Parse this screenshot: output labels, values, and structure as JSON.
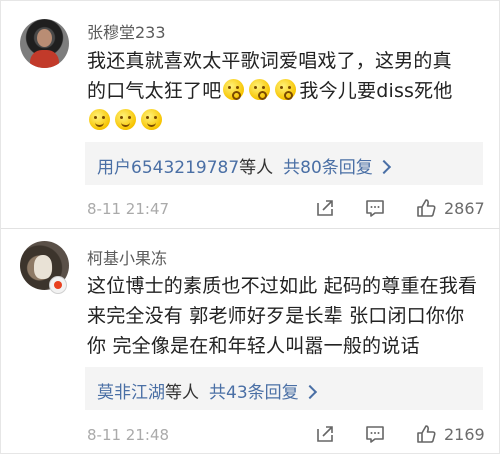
{
  "comments": [
    {
      "username": "张穆堂233",
      "text_line1": "我还真就喜欢太平歌词爱唱戏了，这男的真",
      "text_line2": "的口气太狂了吧",
      "text_after_emojis": "我今儿要diss死他",
      "emojis_inline": [
        "thinking-emoji",
        "thinking-emoji",
        "thinking-emoji"
      ],
      "emojis_line3": [
        "smile-emoji",
        "smile-emoji",
        "smile-emoji"
      ],
      "reply_user": "用户6543219787",
      "reply_suffix": "等人",
      "reply_count": "共80条回复",
      "timestamp": "8-11 21:47",
      "likes": "2867"
    },
    {
      "username": "柯基小果冻",
      "text": "这位博士的素质也不过如此 起码的尊重在我看来完全没有 郭老师好歹是长辈 张口闭口你你你 完全像是在和年轻人叫嚣一般的说话",
      "reply_user": "莫非江湖",
      "reply_suffix": "等人",
      "reply_count": "共43条回复",
      "timestamp": "8-11 21:48",
      "likes": "2169"
    }
  ],
  "colors": {
    "link": "#4a6fa5",
    "text": "#222222",
    "meta": "#aaaaaa",
    "reply_bg": "#f4f4f4"
  }
}
